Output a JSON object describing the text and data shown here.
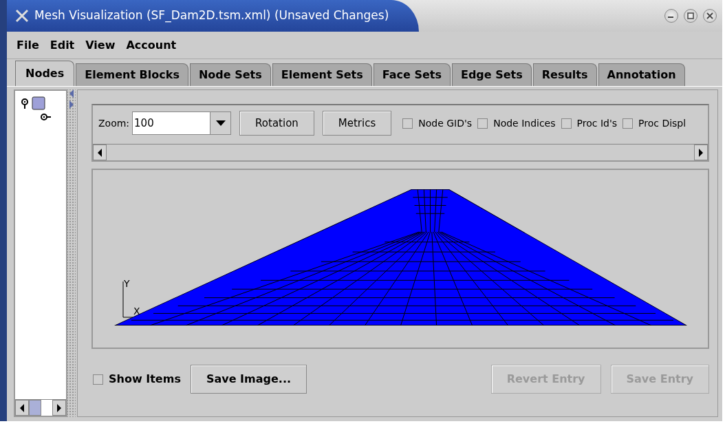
{
  "window": {
    "title": "Mesh Visualization (SF_Dam2D.tsm.xml) (Unsaved Changes)"
  },
  "menu": [
    "File",
    "Edit",
    "View",
    "Account"
  ],
  "tabs": [
    {
      "label": "Nodes",
      "selected": true
    },
    {
      "label": "Element Blocks",
      "selected": false
    },
    {
      "label": "Node Sets",
      "selected": false
    },
    {
      "label": "Element Sets",
      "selected": false
    },
    {
      "label": "Face Sets",
      "selected": false
    },
    {
      "label": "Edge Sets",
      "selected": false
    },
    {
      "label": "Results",
      "selected": false
    },
    {
      "label": "Annotation",
      "selected": false
    }
  ],
  "toolbar": {
    "zoom_label": "Zoom:",
    "zoom_value": "100",
    "buttons": [
      "Rotation",
      "Metrics"
    ],
    "checkboxes": [
      {
        "label": "Node GID's",
        "checked": false
      },
      {
        "label": "Node Indices",
        "checked": false
      },
      {
        "label": "Proc Id's",
        "checked": false
      },
      {
        "label": "Proc Displ",
        "checked": false
      }
    ]
  },
  "viewport": {
    "axes": {
      "y": "Y",
      "x": "X"
    }
  },
  "footer": {
    "show_items": {
      "label": "Show Items",
      "checked": false
    },
    "buttons": [
      {
        "label": "Save Image...",
        "disabled": false
      },
      {
        "label": "Revert Entry",
        "disabled": true
      },
      {
        "label": "Save Entry",
        "disabled": true
      }
    ]
  }
}
